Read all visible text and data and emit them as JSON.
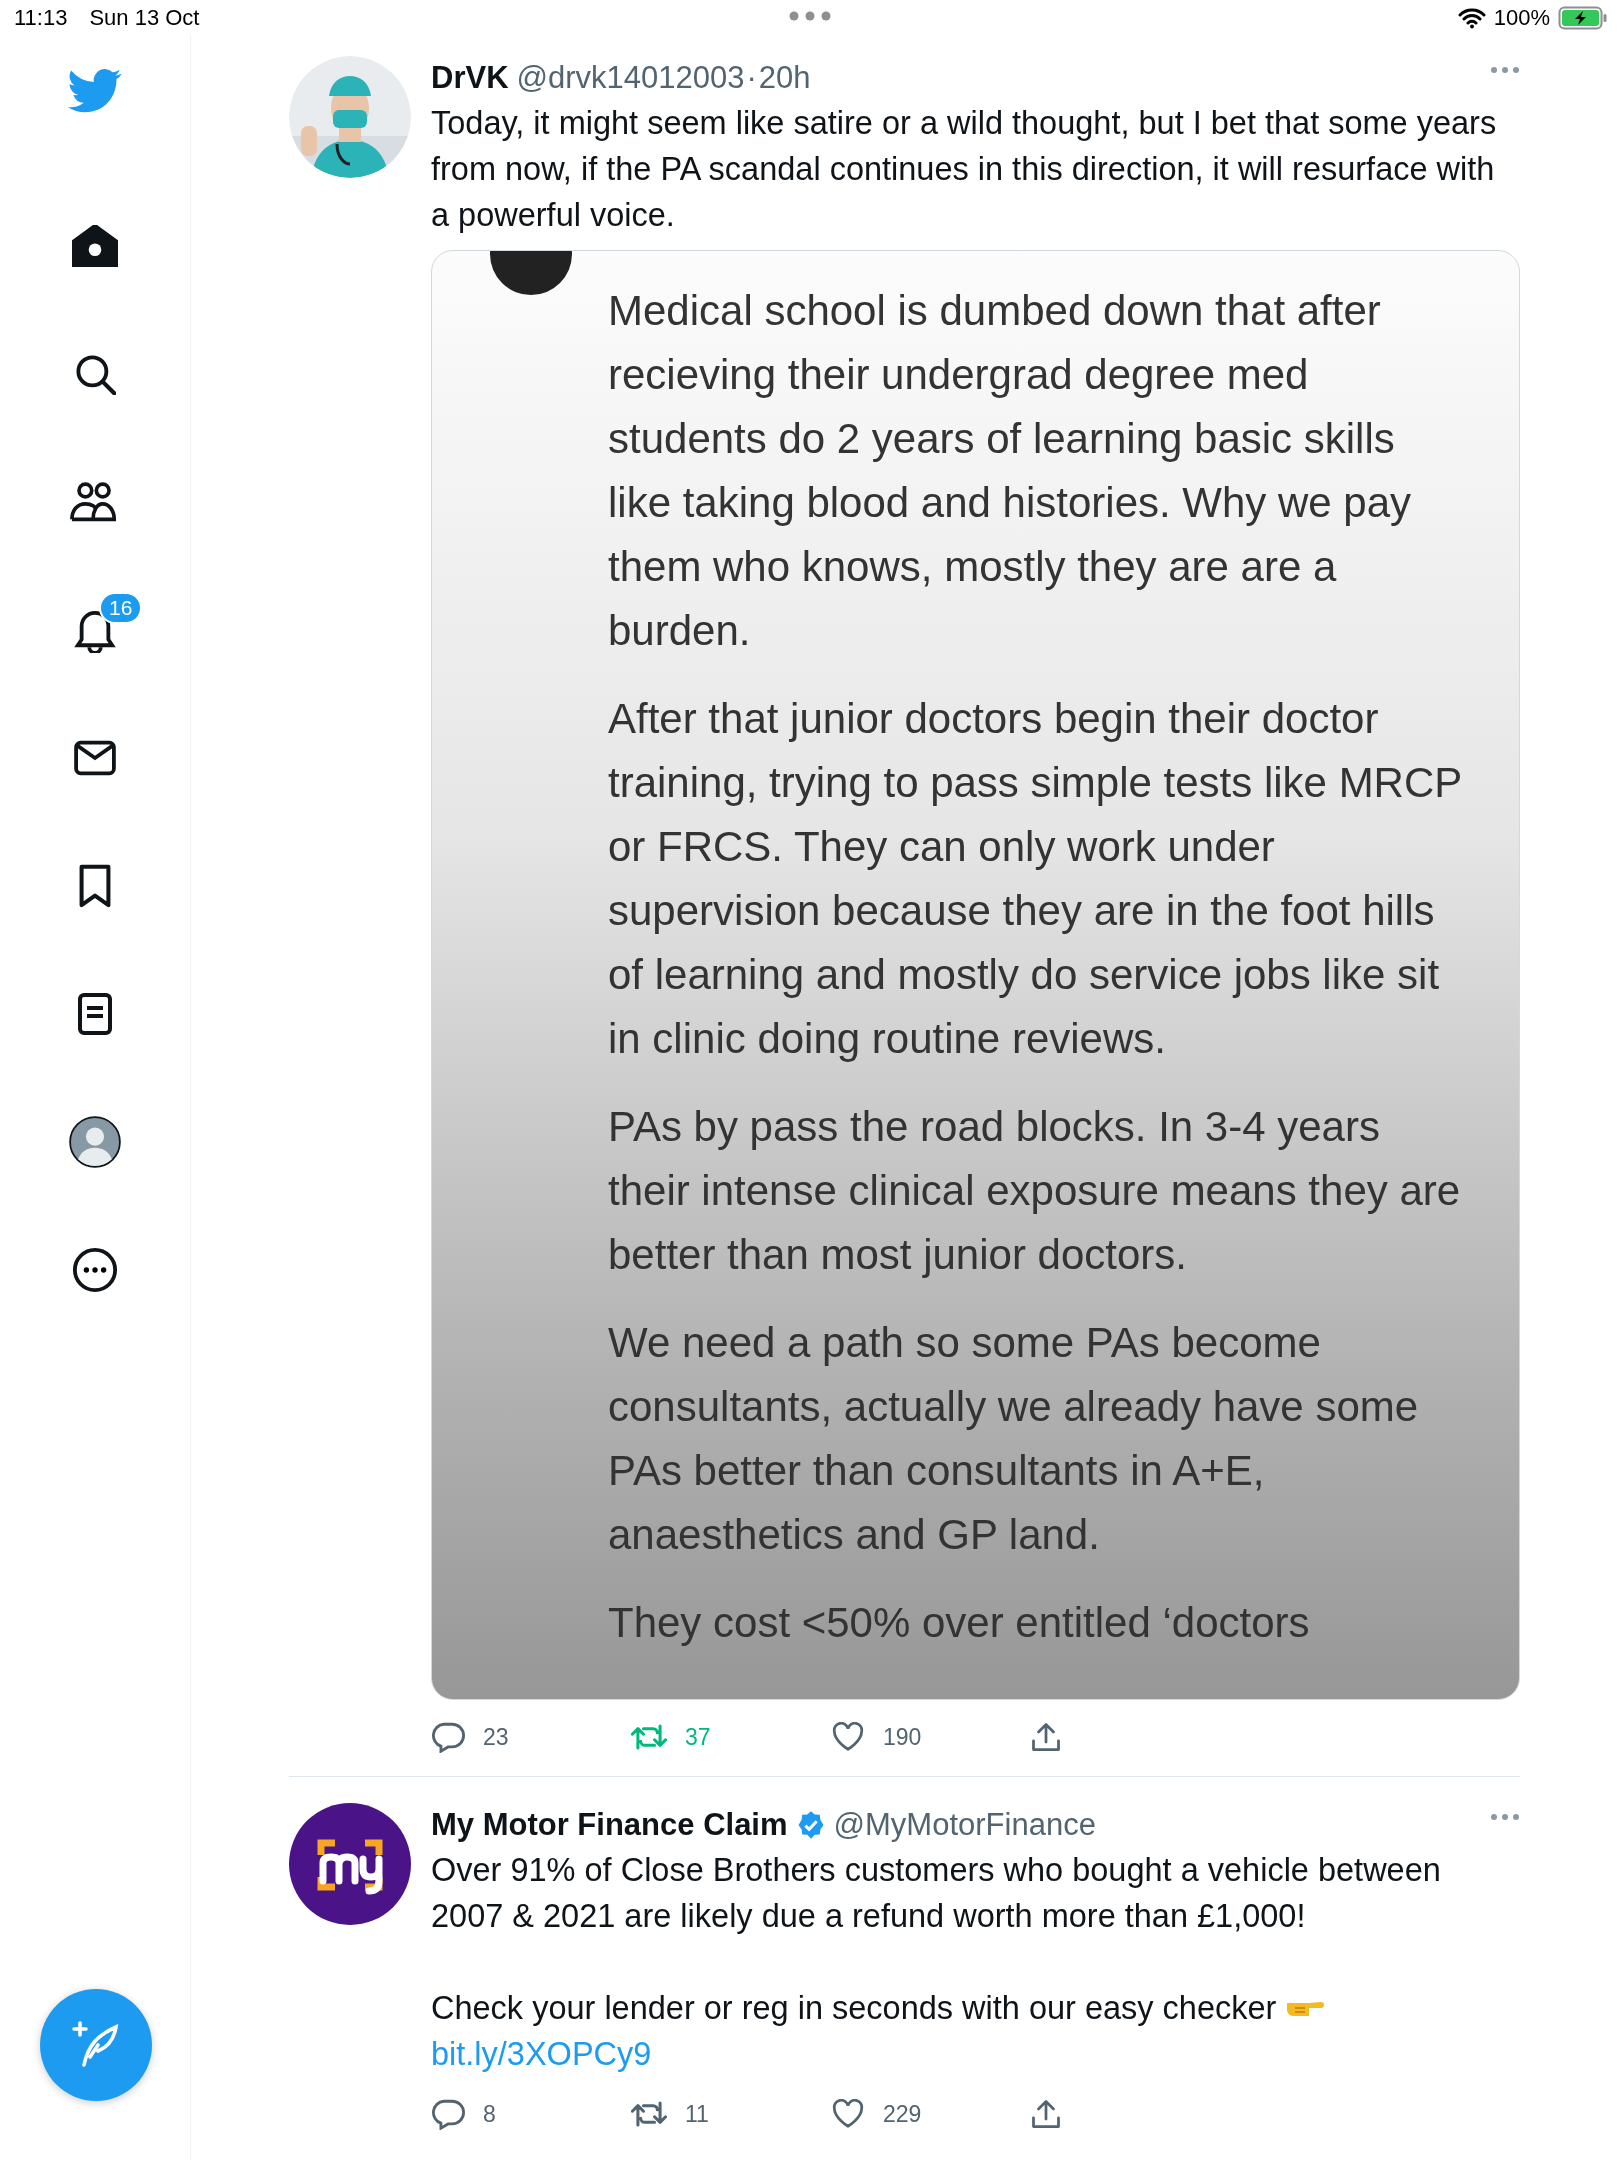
{
  "status_bar": {
    "time": "11:13",
    "date": "Sun 13 Oct",
    "battery": "100%"
  },
  "sidebar": {
    "items": [
      {
        "kind": "logo"
      },
      {
        "kind": "home",
        "selected": true
      },
      {
        "kind": "search",
        "selected": false
      },
      {
        "kind": "communities",
        "selected": false
      },
      {
        "kind": "notifications",
        "selected": false,
        "badge": "16"
      },
      {
        "kind": "messages",
        "selected": false
      },
      {
        "kind": "bookmarks",
        "selected": false
      },
      {
        "kind": "lists",
        "selected": false
      },
      {
        "kind": "profile",
        "selected": false
      },
      {
        "kind": "more",
        "selected": false
      }
    ]
  },
  "tweets": [
    {
      "avatar": {
        "kind": "picture"
      },
      "name": "DrVK",
      "handle": "@drvk14012003",
      "separator": "·",
      "time": "20h",
      "paragraphs": [
        {
          "text": "Today, it might seem like satire or a wild thought, but I bet that some years from now, if the PA scandal continues in this direction, it will resurface with a powerful voice."
        }
      ],
      "embed": {
        "paragraphs": [
          "Medical school is dumbed down that after recieving their undergrad degree med students do 2 years of learning basic skills like taking blood and histories. Why we pay them who knows, mostly they are are a burden.",
          "After that junior doctors begin their doctor training, trying to pass simple tests like MRCP or FRCS. They can only work under supervision because they are in the foot hills of learning and mostly do service jobs like sit in clinic doing routine reviews.",
          "PAs by pass the road blocks. In 3-4 years their intense clinical exposure means they are better than most junior doctors.",
          "We need a path so some PAs become consultants, actually we already have some PAs better than consultants in A+E, anaesthetics and GP land.",
          "They cost <50% over entitled ‘doctors"
        ]
      },
      "actions": {
        "replies": "23",
        "retweets": "37",
        "retweeted": true,
        "likes": "190",
        "liked": false
      }
    },
    {
      "avatar": {
        "kind": "logo"
      },
      "name": "My Motor Finance Claim",
      "verified": true,
      "handle": "@MyMotorFinance",
      "paragraphs": [
        {
          "text": "Over 91% of Close Brothers customers who bought a vehicle between 2007 & 2021 are likely due a refund worth more than £1,000!"
        },
        {
          "text": "Check your lender or reg in seconds with our easy checker",
          "link": "bit.ly/3XOPCy9"
        }
      ],
      "actions": {
        "replies": "8",
        "retweets": "11",
        "retweeted": false,
        "likes": "229",
        "liked": false
      }
    }
  ]
}
